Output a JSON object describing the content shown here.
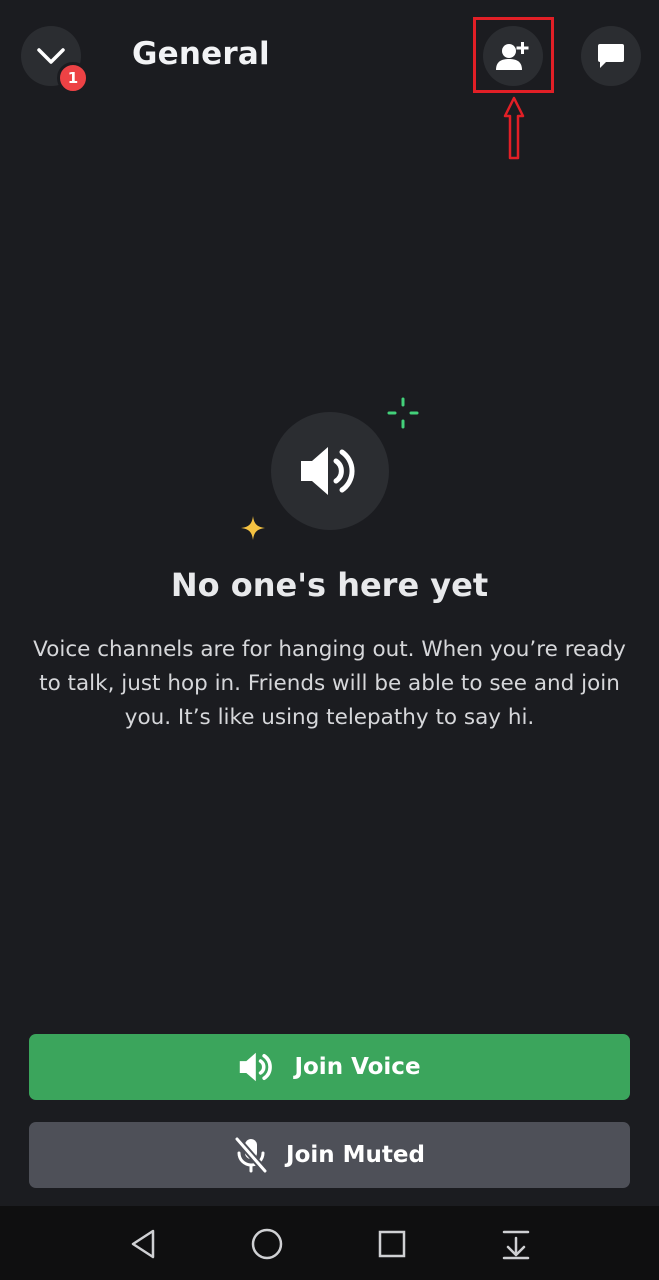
{
  "header": {
    "title": "General",
    "notification_count": "1"
  },
  "empty_state": {
    "title": "No one's here yet",
    "description": "Voice channels are for hanging out. When you’re ready to talk, just hop in. Friends will be able to see and join you. It’s like using telepathy to say hi."
  },
  "actions": {
    "join_voice": "Join Voice",
    "join_muted": "Join Muted"
  },
  "icons": {
    "collapse": "chevron-down-icon",
    "invite": "add-user-icon",
    "chat": "chat-icon",
    "voice": "speaker-icon",
    "muted": "mic-off-icon",
    "nav": [
      "back-icon",
      "home-icon",
      "recents-icon",
      "notifications-down-icon"
    ]
  },
  "colors": {
    "background": "#1b1c20",
    "join_voice": "#3ba55c",
    "join_muted": "#4e5058",
    "badge": "#ed4245",
    "highlight": "#e21f26",
    "sparkle_green": "#43d17a",
    "sparkle_yellow": "#f5c242"
  }
}
